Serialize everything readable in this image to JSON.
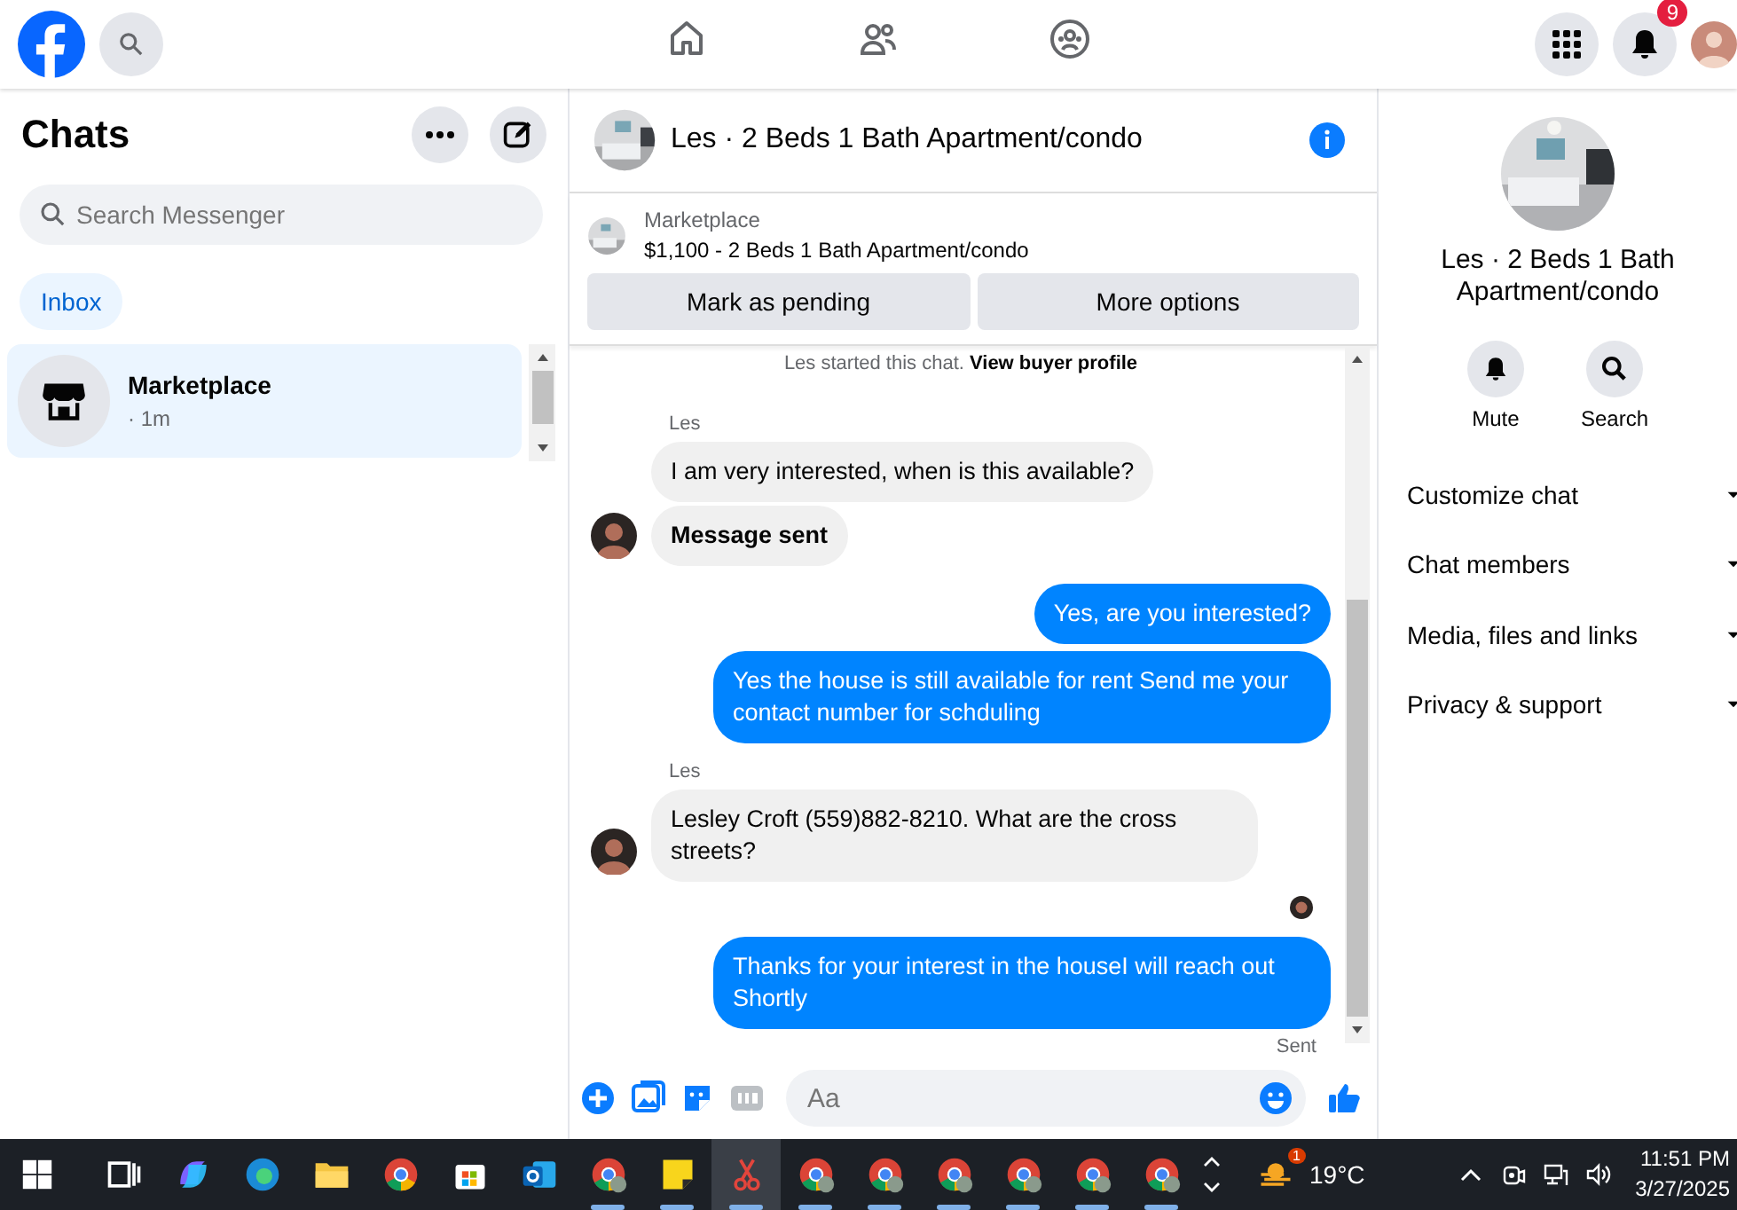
{
  "top_bar": {
    "nav": [
      {
        "kind": "home",
        "selected": false
      },
      {
        "kind": "friends",
        "selected": false
      },
      {
        "kind": "groups",
        "selected": false
      }
    ],
    "notifications_badge": "9"
  },
  "chats_panel": {
    "title": "Chats",
    "search": {
      "placeholder": "Search Messenger"
    },
    "filter": {
      "label": "Inbox",
      "selected": true
    },
    "conversations": [
      {
        "name": "Marketplace",
        "time": "· 1m",
        "selected": true
      }
    ]
  },
  "conversation": {
    "title": "Les · 2 Beds 1 Bath Apartment/condo",
    "listing": {
      "source": "Marketplace",
      "summary": "$1,100 - 2 Beds 1 Bath Apartment/condo",
      "buttons": [
        "Mark as pending",
        "More options"
      ]
    },
    "notice": {
      "text": "Les started this chat.",
      "link": "View buyer profile"
    },
    "messages": [
      {
        "kind": "incoming",
        "sender": "Les",
        "text": "I am very interested, when is this available?",
        "bold": false,
        "avatar": false
      },
      {
        "kind": "incoming",
        "text": "Message sent",
        "bold": true,
        "avatar": true
      },
      {
        "kind": "outgoing",
        "text": "Yes, are you interested?",
        "bold": false
      },
      {
        "kind": "outgoing",
        "text": "Yes the house is still available for rent Send me your contact number for schduling",
        "bold": false
      },
      {
        "kind": "incoming",
        "sender": "Les",
        "text": "Lesley Croft (559)882-8210. What are the cross streets?",
        "bold": false,
        "avatar": true
      },
      {
        "kind": "seen"
      },
      {
        "kind": "outgoing",
        "text": "Thanks for your interest in the houseI will reach out Shortly",
        "bold": false,
        "status": "Sent"
      }
    ],
    "composer": {
      "placeholder": "Aa"
    }
  },
  "details_panel": {
    "title": "Les · 2 Beds 1 Bath Apartment/condo",
    "actions": [
      {
        "kind": "mute",
        "label": "Mute"
      },
      {
        "kind": "search",
        "label": "Search"
      }
    ],
    "sections": [
      {
        "label": "Customize chat",
        "expanded": false
      },
      {
        "label": "Chat members",
        "expanded": false
      },
      {
        "label": "Media, files and links",
        "expanded": false
      },
      {
        "label": "Privacy & support",
        "expanded": false
      }
    ]
  },
  "taskbar": {
    "apps": [
      {
        "kind": "task-view",
        "running": false,
        "selected": false
      },
      {
        "kind": "copilot",
        "running": false,
        "selected": false
      },
      {
        "kind": "edge",
        "running": false,
        "selected": false
      },
      {
        "kind": "folder",
        "running": false,
        "selected": false
      },
      {
        "kind": "chrome",
        "running": false,
        "selected": false
      },
      {
        "kind": "store",
        "running": false,
        "selected": false
      },
      {
        "kind": "outlook",
        "running": false,
        "selected": false
      },
      {
        "kind": "chrome",
        "running": true,
        "selected": false
      },
      {
        "kind": "notes",
        "running": true,
        "selected": false
      },
      {
        "kind": "snip",
        "running": true,
        "selected": true
      },
      {
        "kind": "chrome",
        "running": true,
        "selected": false
      },
      {
        "kind": "chrome",
        "running": true,
        "selected": false
      },
      {
        "kind": "chrome",
        "running": true,
        "selected": false
      },
      {
        "kind": "chrome",
        "running": true,
        "selected": false
      },
      {
        "kind": "chrome",
        "running": true,
        "selected": false
      },
      {
        "kind": "chrome",
        "running": true,
        "selected": false
      }
    ],
    "weather": {
      "badge": "1",
      "temperature": "19°C"
    },
    "time": "11:51 PM",
    "date": "3/27/2025"
  }
}
